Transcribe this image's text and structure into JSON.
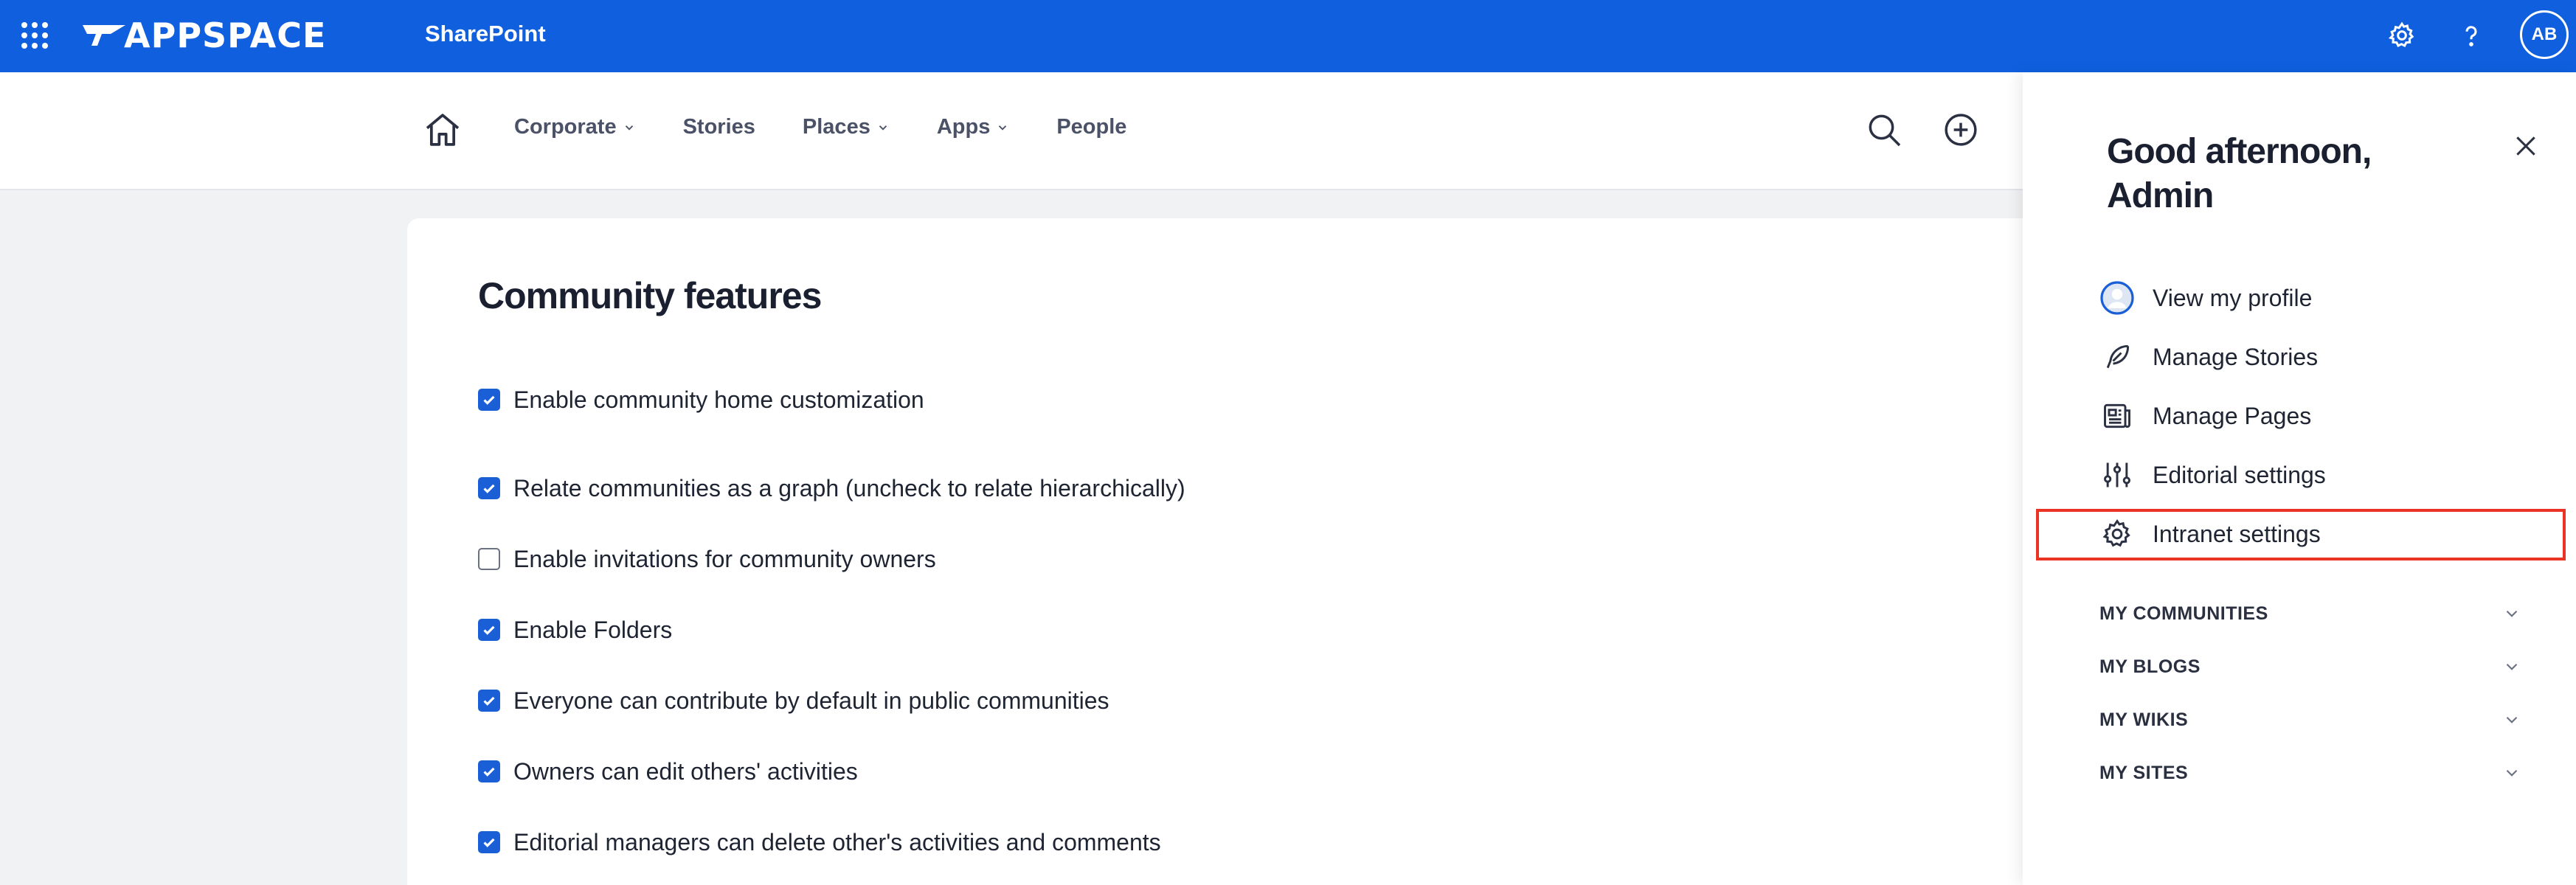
{
  "topbar": {
    "brand": "APPSPACE",
    "product": "SharePoint",
    "avatar_initials": "AB",
    "color": "#0f5fdf"
  },
  "nav": {
    "items": [
      {
        "label": "Corporate",
        "has_dropdown": true
      },
      {
        "label": "Stories",
        "has_dropdown": false
      },
      {
        "label": "Places",
        "has_dropdown": true
      },
      {
        "label": "Apps",
        "has_dropdown": true
      },
      {
        "label": "People",
        "has_dropdown": false
      }
    ]
  },
  "main": {
    "title": "Community features",
    "features": [
      {
        "label": "Enable community home customization",
        "checked": true
      },
      {
        "label": "Relate communities as a graph (uncheck to relate hierarchically)",
        "checked": true
      },
      {
        "label": "Enable invitations for community owners",
        "checked": false
      },
      {
        "label": "Enable Folders",
        "checked": true
      },
      {
        "label": "Everyone can contribute by default in public communities",
        "checked": true
      },
      {
        "label": "Owners can edit others' activities",
        "checked": true
      },
      {
        "label": "Editorial managers can delete other's activities and comments",
        "checked": true
      }
    ]
  },
  "panel": {
    "greeting": "Good afternoon, Admin",
    "menu": [
      {
        "label": "View my profile",
        "icon": "profile-icon"
      },
      {
        "label": "Manage Stories",
        "icon": "feather-icon"
      },
      {
        "label": "Manage Pages",
        "icon": "pages-icon"
      },
      {
        "label": "Editorial settings",
        "icon": "sliders-icon"
      },
      {
        "label": "Intranet settings",
        "icon": "gear-icon",
        "highlighted": true
      }
    ],
    "sections": [
      {
        "label": "MY COMMUNITIES"
      },
      {
        "label": "MY BLOGS"
      },
      {
        "label": "MY WIKIS"
      },
      {
        "label": "MY SITES"
      }
    ],
    "highlight_color": "#ea3323"
  }
}
